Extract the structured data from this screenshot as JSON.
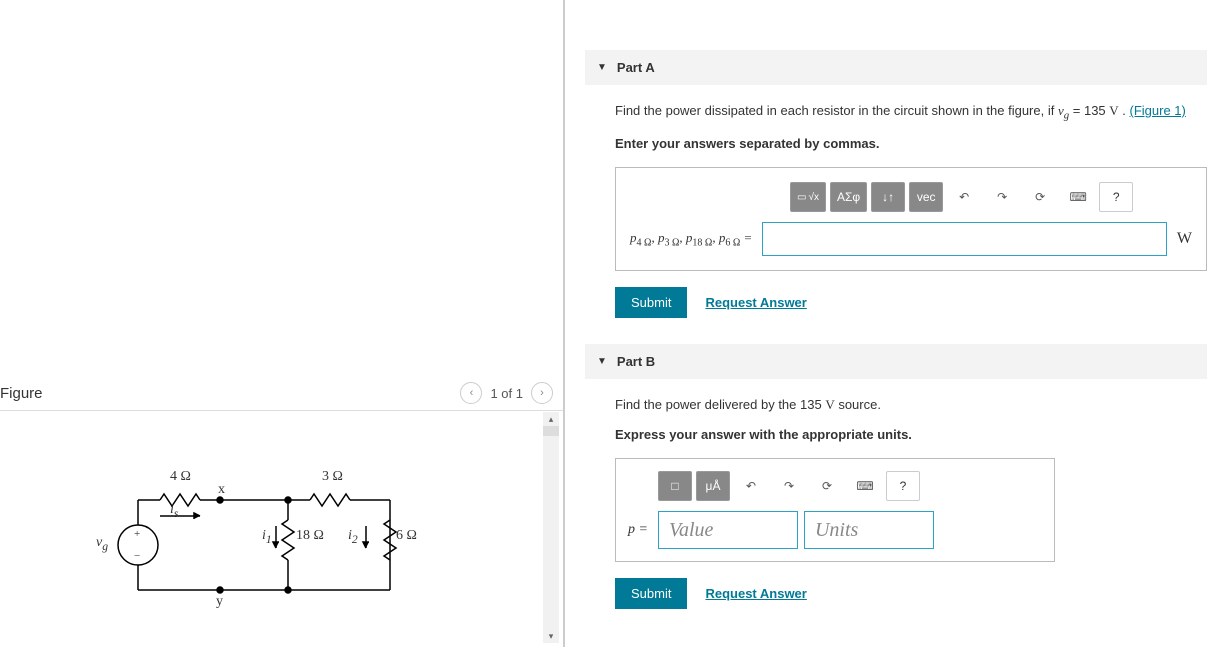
{
  "figure": {
    "title": "Figure",
    "pager": "1 of 1",
    "labels": {
      "r4": "4 Ω",
      "r3": "3 Ω",
      "r18": "18 Ω",
      "r6": "6 Ω",
      "x": "x",
      "y": "y",
      "is": "i",
      "is_sub": "s",
      "i1": "i",
      "i1_sub": "1",
      "i2": "i",
      "i2_sub": "2",
      "vg": "v",
      "vg_sub": "g",
      "plus": "+",
      "minus": "−"
    }
  },
  "partA": {
    "title": "Part A",
    "prompt_pre": "Find the power dissipated in each resistor in the circuit shown in the figure, if ",
    "var": "v",
    "var_sub": "g",
    "prompt_eq": " = 135 ",
    "volt": "V",
    "prompt_post": " . ",
    "fig_link": "(Figure 1)",
    "instruction": "Enter your answers separated by commas.",
    "lhs_p4": "p",
    "lhs_4": "4 Ω",
    "lhs_p3": "p",
    "lhs_3": "3 Ω",
    "lhs_p18": "p",
    "lhs_18": "18 Ω",
    "lhs_p6": "p",
    "lhs_6": "6 Ω",
    "equals": " =",
    "unit": "W",
    "toolbar": {
      "b1": "√x",
      "b2": "ΑΣφ",
      "b3": "↓↑",
      "b4": "vec",
      "undo": "↶",
      "redo": "↷",
      "reset": "⟳",
      "keyb": "⌨",
      "help": "?"
    },
    "submit": "Submit",
    "request": "Request Answer"
  },
  "partB": {
    "title": "Part B",
    "prompt_pre": "Find the power delivered by the 135 ",
    "volt": "V",
    "prompt_post": " source.",
    "instruction": "Express your answer with the appropriate units.",
    "toolbar": {
      "b1": "□",
      "b2": "μÅ",
      "undo": "↶",
      "redo": "↷",
      "reset": "⟳",
      "keyb": "⌨",
      "help": "?"
    },
    "lhs": "p =",
    "value_ph": "Value",
    "units_ph": "Units",
    "submit": "Submit",
    "request": "Request Answer"
  }
}
